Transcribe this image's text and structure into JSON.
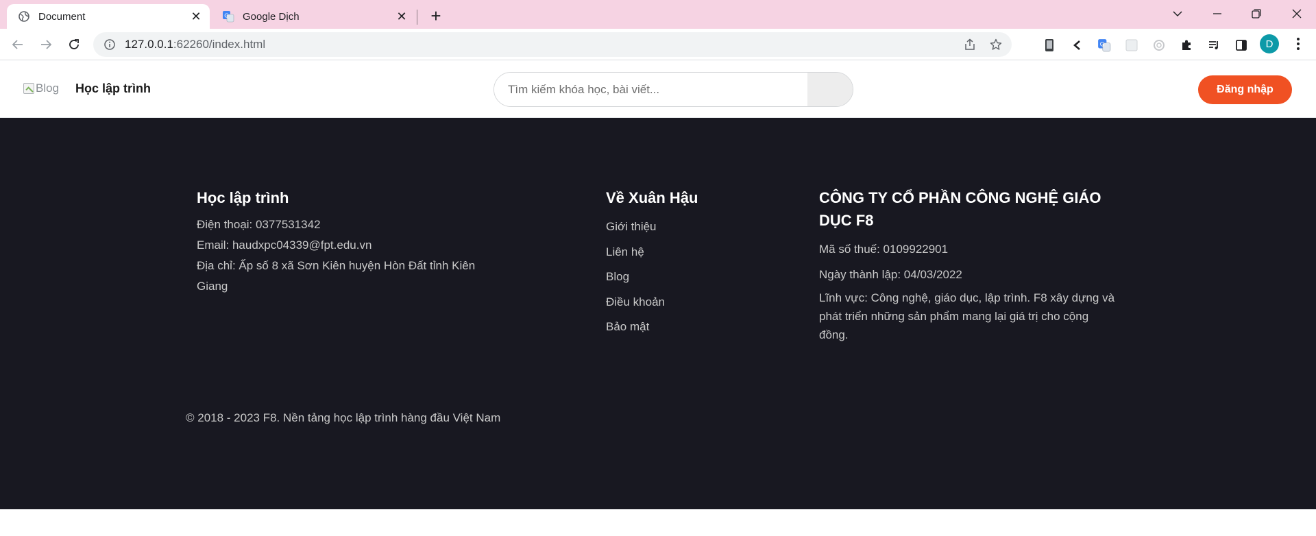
{
  "browser": {
    "tabs": [
      {
        "title": "Document",
        "icon": "globe-icon",
        "active": true
      },
      {
        "title": "Google Dịch",
        "icon": "google-translate-icon",
        "active": false
      }
    ],
    "url_host": "127.0.0.1",
    "url_rest": ":62260/index.html",
    "avatar_letter": "D",
    "colors": {
      "tabstrip": "#f6d3e3",
      "avatar": "#0d9aa8"
    }
  },
  "header": {
    "logo_alt": "Blog",
    "brand": "Học lập trình",
    "search_placeholder": "Tìm kiếm khóa học, bài viết...",
    "login_label": "Đăng nhập",
    "colors": {
      "login_button": "#f05123"
    }
  },
  "footer": {
    "background": "#181821",
    "col1": {
      "title": "Học lập trình",
      "phone": "Điện thoại: 0377531342",
      "email": "Email: haudxpc04339@fpt.edu.vn",
      "address": "Địa chỉ: Ấp số 8 xã Sơn Kiên huyện Hòn Đất tỉnh Kiên Giang"
    },
    "col2": {
      "title": "Về Xuân Hậu",
      "links": [
        "Giới thiệu",
        "Liên hệ",
        "Blog",
        "Điều khoản",
        "Bảo mật"
      ]
    },
    "col3": {
      "title": "CÔNG TY CỔ PHẦN CÔNG NGHỆ GIÁO DỤC F8",
      "tax": "Mã số thuế: 0109922901",
      "founded": "Ngày thành lập: 04/03/2022",
      "field": "Lĩnh vực: Công nghệ, giáo dục, lập trình. F8 xây dựng và phát triển những sản phẩm mang lại giá trị cho cộng đồng."
    },
    "copyright": "© 2018 - 2023 F8. Nền tảng học lập trình hàng đầu Việt Nam"
  }
}
